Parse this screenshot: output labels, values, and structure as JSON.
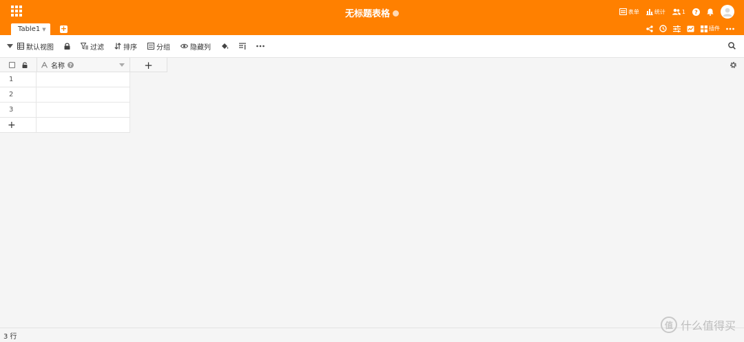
{
  "header": {
    "title": "无标题表格",
    "actions": {
      "form": "表单",
      "stats": "统计",
      "collaborators_count": "1"
    }
  },
  "tabs": [
    {
      "label": "Table1"
    }
  ],
  "tab_actions": {
    "plugins": "插件"
  },
  "toolbar": {
    "view_name": "默认视图",
    "filter": "过滤",
    "sort": "排序",
    "group": "分组",
    "hide_columns": "隐藏列"
  },
  "grid": {
    "columns": [
      {
        "name": "名称",
        "type": "text"
      }
    ],
    "rows": [
      {
        "index": "1",
        "name": ""
      },
      {
        "index": "2",
        "name": ""
      },
      {
        "index": "3",
        "name": ""
      }
    ],
    "add_row_label": "+",
    "add_column_label": "+"
  },
  "footer": {
    "row_count": "3 行"
  },
  "watermark": {
    "logo": "值",
    "text": "什么值得买"
  },
  "colors": {
    "brand": "#ff8000",
    "background": "#f5f5f5"
  }
}
